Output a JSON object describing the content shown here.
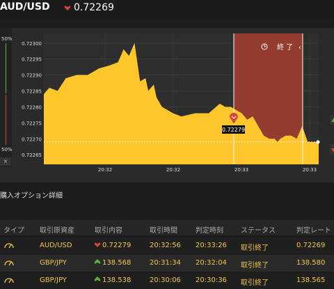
{
  "header": {
    "pair": "AUD/USD",
    "rate": "0.72269"
  },
  "side": {
    "top_percent": "50%",
    "bottom_percent": "50%",
    "close_label": "×"
  },
  "chart": {
    "end_label": "終 了",
    "current_price_label": "0.72279",
    "colors": {
      "fill": "#ffc72c",
      "end_zone": "#a9402f",
      "background": "#2a2a2a"
    }
  },
  "chart_data": {
    "type": "area",
    "title": "",
    "xlabel": "",
    "ylabel": "",
    "x_tick_labels": [
      "20:32",
      "20:32",
      "20:33",
      "20:33"
    ],
    "y_tick_labels": [
      "0.72300",
      "0.72295",
      "0.72290",
      "0.72285",
      "0.72280",
      "0.72275",
      "0.72270",
      "0.72265"
    ],
    "ylim": [
      0.72262,
      0.72303
    ],
    "x_range": [
      0,
      100
    ],
    "series": [
      {
        "x": [
          0,
          2,
          5,
          8,
          12,
          16,
          20,
          24,
          27,
          29,
          31,
          33,
          35,
          37,
          38,
          40,
          41,
          43,
          45,
          47,
          50,
          55,
          60,
          64,
          66,
          68,
          70,
          72,
          74,
          76,
          80,
          82,
          84,
          85,
          86,
          88,
          90,
          92,
          94,
          96,
          98,
          100
        ],
        "values": [
          0.72284,
          0.72286,
          0.72285,
          0.72289,
          0.7229,
          0.7229,
          0.72292,
          0.72293,
          0.72294,
          0.72298,
          0.72296,
          0.723,
          0.72288,
          0.72289,
          0.72285,
          0.72287,
          0.72283,
          0.7228,
          0.72279,
          0.72278,
          0.72277,
          0.72278,
          0.72278,
          0.72281,
          0.7228,
          0.7228,
          0.72279,
          0.72278,
          0.72276,
          0.72277,
          0.72271,
          0.7227,
          0.7227,
          0.72269,
          0.7227,
          0.72271,
          0.72271,
          0.7227,
          0.72274,
          0.72269,
          0.72269,
          0.72269
        ]
      }
    ],
    "grid": true
  },
  "section": {
    "title": "購入オプション詳細"
  },
  "table": {
    "columns": [
      "タイプ",
      "取引原資産",
      "取引内容",
      "取引時間",
      "判定時刻",
      "ステータス",
      "判定レート"
    ],
    "rows": [
      {
        "asset": "AUD/USD",
        "direction": "down",
        "content": "0.72279",
        "trade_time": "20:32:56",
        "judge_time": "20:33:26",
        "status": "取引終了",
        "judge_rate": "0.72269"
      },
      {
        "asset": "GBP/JPY",
        "direction": "up",
        "content": "138.568",
        "trade_time": "20:31:34",
        "judge_time": "20:32:04",
        "status": "取引終了",
        "judge_rate": "138.580"
      },
      {
        "asset": "GBP/JPY",
        "direction": "up",
        "content": "138.538",
        "trade_time": "20:30:06",
        "judge_time": "20:30:36",
        "status": "取引終了",
        "judge_rate": "138.565"
      }
    ]
  }
}
